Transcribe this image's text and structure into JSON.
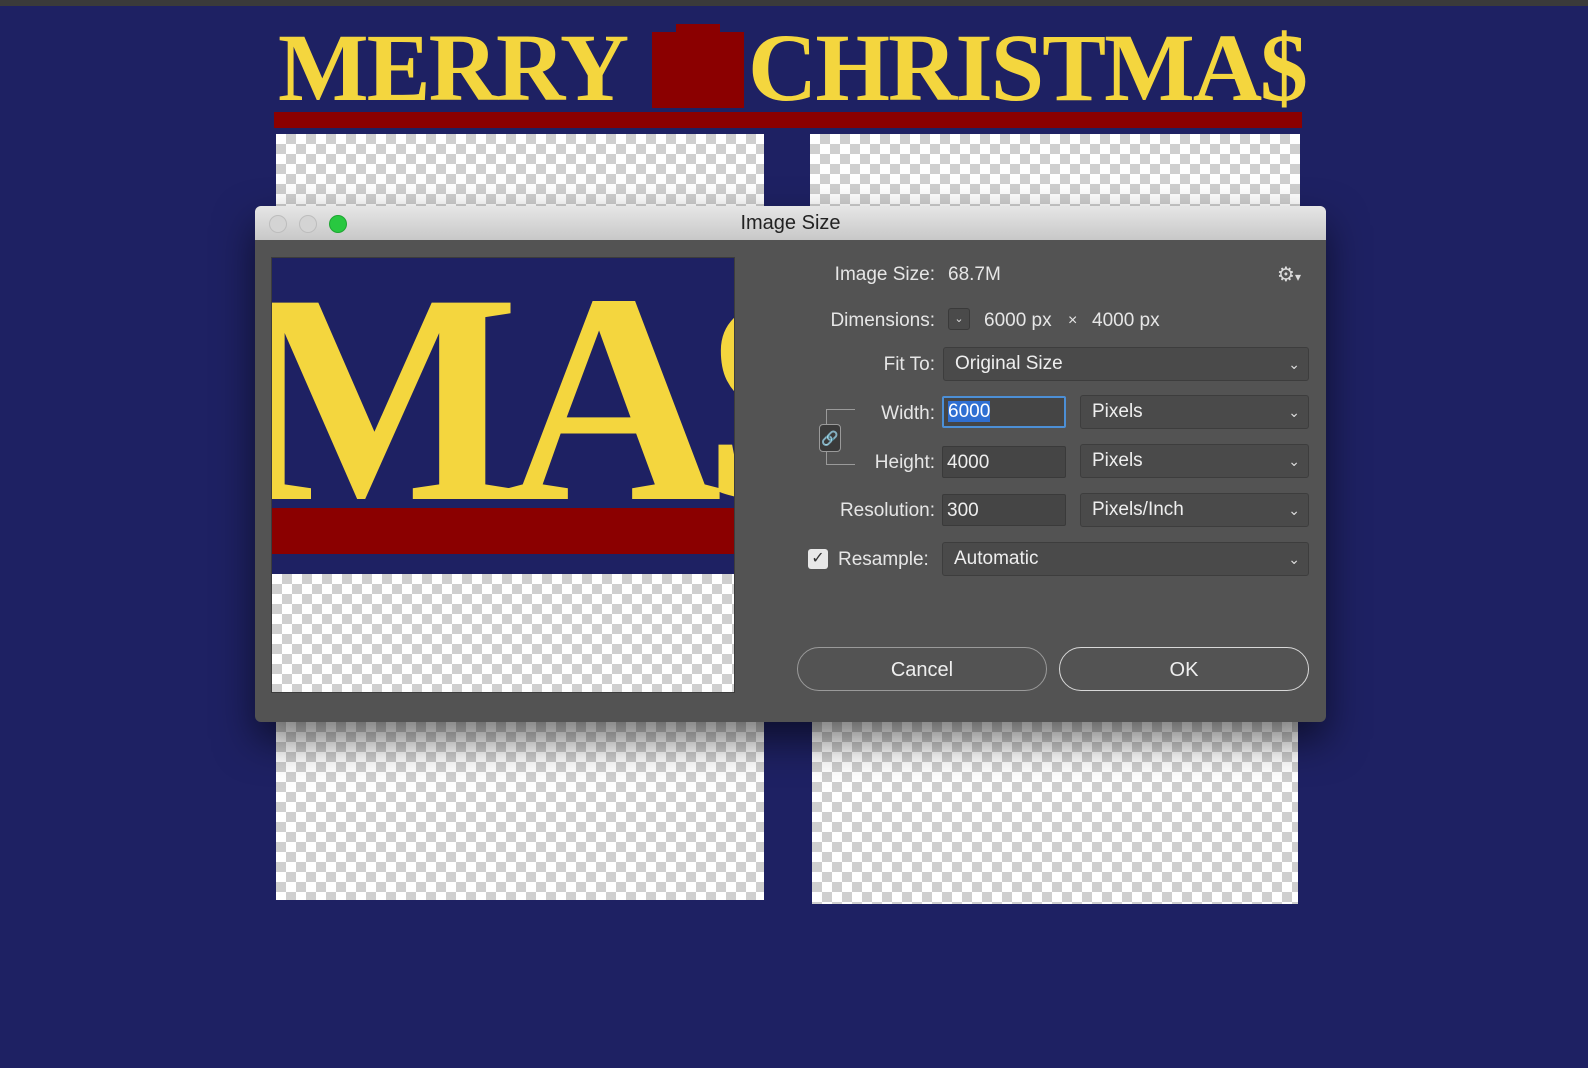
{
  "canvas": {
    "headline_left": "MERRY",
    "headline_right": "CHRISTMA$",
    "preview_letters": "MA$"
  },
  "dialog": {
    "title": "Image Size",
    "image_size_label": "Image Size:",
    "image_size_value": "68.7M",
    "dimensions_label": "Dimensions:",
    "dimensions_width": "6000 px",
    "dimensions_sep": "×",
    "dimensions_height": "4000 px",
    "fit_to_label": "Fit To:",
    "fit_to_value": "Original Size",
    "width_label": "Width:",
    "width_value": "6000",
    "width_unit": "Pixels",
    "height_label": "Height:",
    "height_value": "4000",
    "height_unit": "Pixels",
    "resolution_label": "Resolution:",
    "resolution_value": "300",
    "resolution_unit": "Pixels/Inch",
    "resample_label": "Resample:",
    "resample_checked": true,
    "resample_value": "Automatic",
    "cancel_label": "Cancel",
    "ok_label": "OK"
  },
  "icons": {
    "gear": "gear-icon",
    "link": "link-icon",
    "chevron": "chevron-down-icon"
  },
  "colors": {
    "background": "#1e2163",
    "headline": "#f4d63e",
    "accent_red": "#8b0000",
    "dialog_bg": "#535353",
    "selection": "#2f6fd2"
  }
}
